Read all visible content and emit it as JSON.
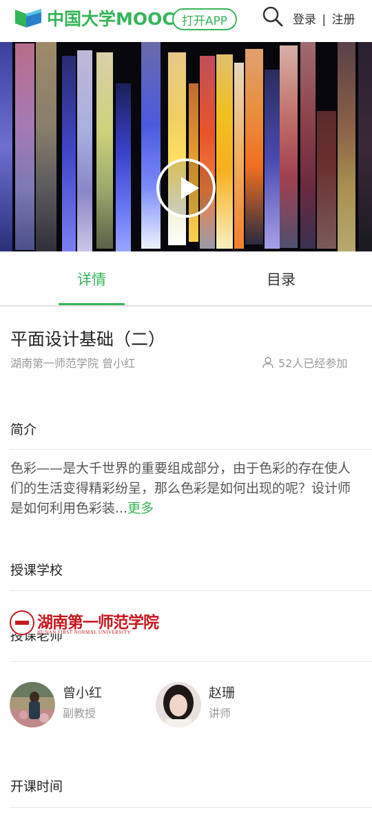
{
  "header": {
    "logo_text": "中国大学MOOC",
    "open_app_label": "打开APP",
    "login_label": "登录",
    "separator": "|",
    "register_label": "注册",
    "brand_color": "#35b558",
    "icons": [
      "mooc-logo-icon",
      "search-icon"
    ]
  },
  "video": {
    "play_icon": "play-icon"
  },
  "tabs": [
    {
      "label": "详情",
      "active": true
    },
    {
      "label": "目录",
      "active": false
    }
  ],
  "course": {
    "title": "平面设计基础（二）",
    "meta": "湖南第一师范学院 曾小红",
    "enrolled": "52人已经参加",
    "enrolled_icon": "user-icon"
  },
  "sections": {
    "intro_title": "简介",
    "intro_text": "色彩——是大千世界的重要组成部分，由于色彩的存在使人们的生活变得精彩纷呈，那么色彩是如何出现的呢？设计师是如何利用色彩装...",
    "more_label": "更多",
    "school_title": "授课学校",
    "teachers_title": "授课老师",
    "schedule_title": "开课时间"
  },
  "school": {
    "name": "湖南第一师范学院",
    "name_en": "HUNAN FIRST NORMAL UNIVERSITY",
    "brand_color": "#c8161d"
  },
  "teachers": [
    {
      "name": "曾小红",
      "title": "副教授"
    },
    {
      "name": "赵珊",
      "title": "讲师"
    }
  ]
}
